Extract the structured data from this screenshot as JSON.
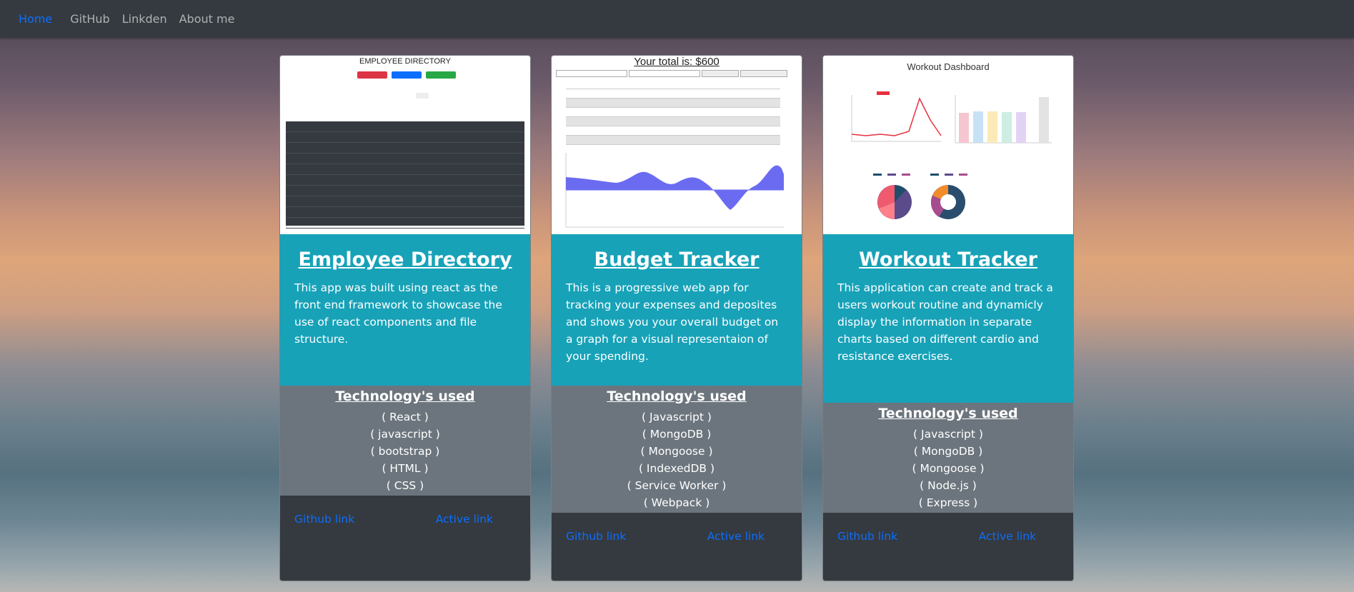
{
  "nav": {
    "home": "Home",
    "github": "GitHub",
    "linkedin": "Linkden",
    "about": "About me"
  },
  "projects": [
    {
      "title": "Employee Directory",
      "description": "This app was built using react as the front end framework to showcase the use of react components and file structure.",
      "tech_title": "Technology's used",
      "tech": [
        "( React )",
        "( javascript )",
        "( bootstrap )",
        "( HTML )",
        "( CSS )"
      ],
      "github_link": "Github link",
      "active_link": "Active link",
      "screenshot_title": "EMPLOYEE DIRECTORY"
    },
    {
      "title": "Budget Tracker",
      "description": "This is a progressive web app for tracking your expenses and deposites and shows you your overall budget on a graph for a visual representaion of your spending.",
      "tech_title": "Technology's used",
      "tech": [
        "( Javascript )",
        "( MongoDB )",
        "( Mongoose )",
        "( IndexedDB )",
        "( Service Worker )",
        "( Webpack )"
      ],
      "github_link": "Github link",
      "active_link": "Active link",
      "screenshot_title": "Your total is: $600"
    },
    {
      "title": "Workout Tracker",
      "description": "This application can create and track a users workout routine and dynamicly display the information in separate charts based on different cardio and resistance exercises.",
      "tech_title": "Technology's used",
      "tech": [
        "( Javascript )",
        "( MongoDB )",
        "( Mongoose )",
        "( Node.js )",
        "( Express )"
      ],
      "github_link": "Github link",
      "active_link": "Active link",
      "screenshot_title": "Workout Dashboard"
    }
  ],
  "colors": {
    "navbar": "#343a40",
    "link": "#0d6efd",
    "card_body": "#17a2b8",
    "card_tech": "#6c757d",
    "card_footer": "#343a40"
  }
}
